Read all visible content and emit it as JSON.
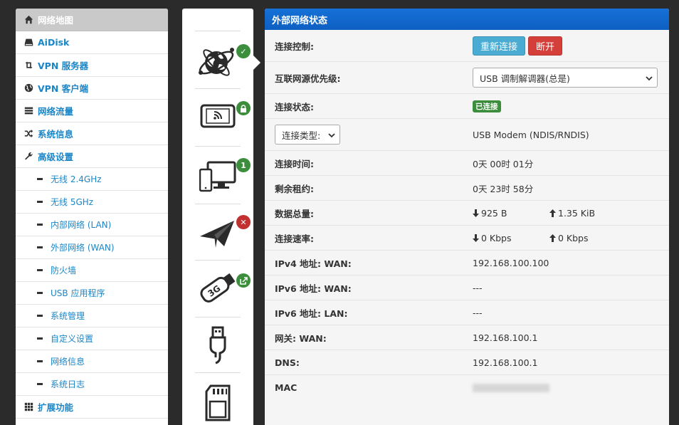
{
  "sidebar": {
    "items": [
      {
        "label": "网络地图",
        "icon": "home-icon",
        "active": true
      },
      {
        "label": "AiDisk",
        "icon": "hdd-icon"
      },
      {
        "label": "VPN 服务器",
        "icon": "retweet-icon"
      },
      {
        "label": "VPN 客户端",
        "icon": "globe-icon"
      },
      {
        "label": "网络流量",
        "icon": "tasks-icon"
      },
      {
        "label": "系统信息",
        "icon": "random-icon"
      },
      {
        "label": "高级设置",
        "icon": "wrench-icon"
      }
    ],
    "subitems": [
      "无线 2.4GHz",
      "无线 5GHz",
      "内部网络 (LAN)",
      "外部网络 (WAN)",
      "防火墙",
      "USB 应用程序",
      "系统管理",
      "自定义设置",
      "网络信息",
      "系统日志"
    ],
    "extra": {
      "label": "扩展功能",
      "icon": "grid-icon"
    }
  },
  "devices": {
    "wan_badge": "✓",
    "wifi_badge": "lock",
    "clients_badge": "1",
    "vpn_badge": "✕",
    "usb3g_badge": "share",
    "usb3g_label": "3G"
  },
  "panel": {
    "title": "外部网络状态",
    "rows": {
      "control": {
        "label": "连接控制:",
        "reconnect": "重新连接",
        "disconnect": "断开"
      },
      "priority": {
        "label": "互联网源优先级:",
        "value": "USB 调制解调器(总是)"
      },
      "status": {
        "label": "连接状态:",
        "value": "已连接"
      },
      "type": {
        "select": "连接类型:",
        "value": "USB Modem (NDIS/RNDIS)"
      },
      "uptime": {
        "label": "连接时间:",
        "value": "0天 00时 01分"
      },
      "lease": {
        "label": "剩余租约:",
        "value": "0天 23时 58分"
      },
      "total": {
        "label": "数据总量:",
        "down": "925 B",
        "up": "1.35 KiB"
      },
      "speed": {
        "label": "连接速率:",
        "down": "0 Kbps",
        "up": "0 Kbps"
      },
      "ipv4_wan": {
        "label": "IPv4 地址: WAN:",
        "value": "192.168.100.100"
      },
      "ipv6_wan": {
        "label": "IPv6 地址: WAN:",
        "value": "---"
      },
      "ipv6_lan": {
        "label": "IPv6 地址: LAN:",
        "value": "---"
      },
      "gateway": {
        "label": "网关: WAN:",
        "value": "192.168.100.1"
      },
      "dns": {
        "label": "DNS:",
        "value": "192.168.100.1"
      },
      "mac": {
        "label": "MAC"
      }
    }
  },
  "colors": {
    "accent": "#1671d6",
    "link": "#1a86c8",
    "success": "#3c8e3c",
    "danger": "#d53f3a",
    "info": "#4aacd2"
  }
}
